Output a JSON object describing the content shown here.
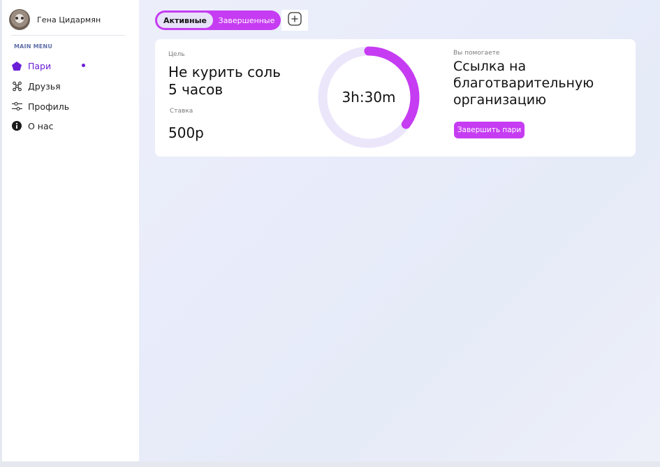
{
  "user": {
    "name": "Гена Цидармян"
  },
  "sidebar": {
    "menu_title": "MAIN MENU",
    "items": [
      {
        "label": "Пари",
        "icon": "home-pentagon-icon",
        "active": true
      },
      {
        "label": "Друзья",
        "icon": "friends-network-icon",
        "active": false
      },
      {
        "label": "Профиль",
        "icon": "sliders-icon",
        "active": false
      },
      {
        "label": "О нас",
        "icon": "info-icon",
        "active": false
      }
    ]
  },
  "tabs": {
    "active": "Активные",
    "completed": "Завершенные",
    "add_icon": "plus-square-icon"
  },
  "bet_card": {
    "goal_label": "Цель",
    "goal_line1": "Не курить соль",
    "goal_line2": "5 часов",
    "stake_label": "Ставка",
    "stake_value": "500р",
    "timer": "3h:30m",
    "progress_fraction": 0.35,
    "help_label": "Вы помогаете",
    "help_line1": "Ссылка на",
    "help_line2": "благотварительную",
    "help_line3": "организацию",
    "finish_button": "Завершить пари"
  },
  "colors": {
    "accent": "#c63cf2",
    "active_menu": "#6b1fd6",
    "ring_track": "#ece6fb",
    "ring_fill": "#c63cf2"
  }
}
